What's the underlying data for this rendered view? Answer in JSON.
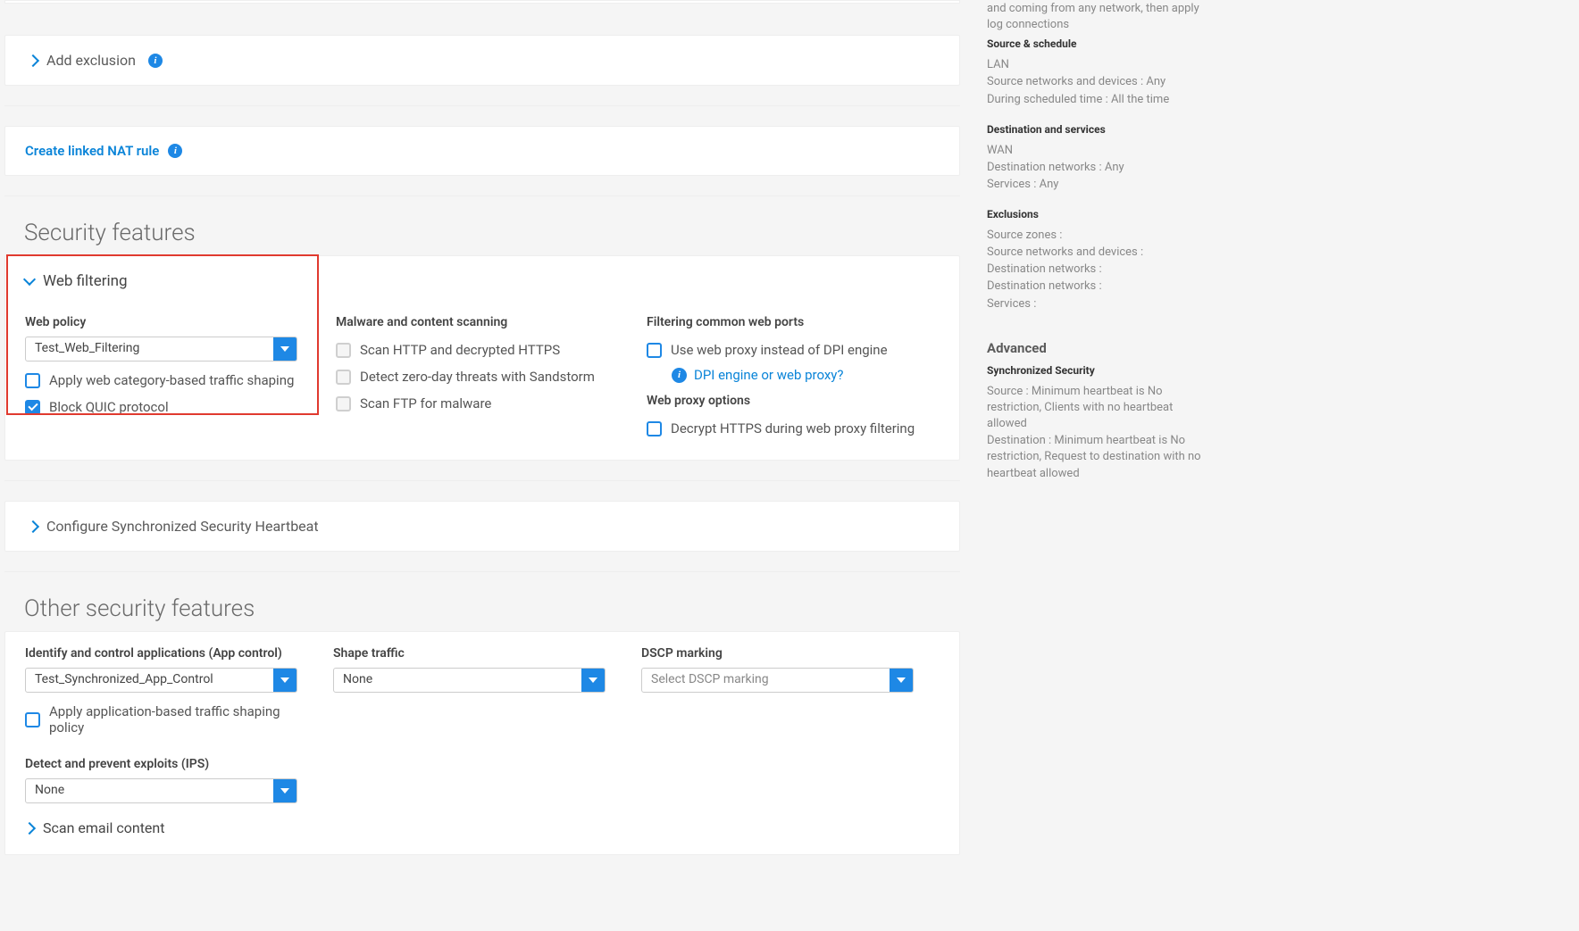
{
  "exclusion": {
    "label": "Add exclusion"
  },
  "nat": {
    "label": "Create linked NAT rule"
  },
  "security_features": {
    "title": "Security features",
    "web_filtering": {
      "header": "Web filtering",
      "web_policy_label": "Web policy",
      "web_policy_value": "Test_Web_Filtering",
      "apply_category": "Apply web category-based traffic shaping",
      "block_quic": "Block QUIC protocol",
      "malware_header": "Malware and content scanning",
      "scan_http": "Scan HTTP and decrypted HTTPS",
      "detect_zero": "Detect zero-day threats with Sandstorm",
      "scan_ftp": "Scan FTP for malware",
      "filtering_header": "Filtering common web ports",
      "use_proxy": "Use web proxy instead of DPI engine",
      "help_link": "DPI engine or web proxy?",
      "webproxy_header": "Web proxy options",
      "decrypt_https": "Decrypt HTTPS during web proxy filtering"
    },
    "sync_security": "Configure Synchronized Security Heartbeat"
  },
  "other": {
    "title": "Other security features",
    "app_control_label": "Identify and control applications (App control)",
    "app_control_value": "Test_Synchronized_App_Control",
    "apply_app_shaping": "Apply application-based traffic shaping policy",
    "shape_label": "Shape traffic",
    "shape_value": "None",
    "dscp_label": "DSCP marking",
    "dscp_placeholder": "Select DSCP marking",
    "ips_label": "Detect and prevent exploits (IPS)",
    "ips_value": "None",
    "scan_email": "Scan email content"
  },
  "sidebar": {
    "intro_tail": "and coming from any network, then apply log connections",
    "source_schedule": {
      "title": "Source & schedule",
      "lan": "LAN",
      "src_net": "Source networks and devices : Any",
      "during": "During scheduled time : All the time"
    },
    "dest_services": {
      "title": "Destination and services",
      "wan": "WAN",
      "dest_net": "Destination networks : Any",
      "services": "Services : Any"
    },
    "exclusions": {
      "title": "Exclusions",
      "src_zones": "Source zones :",
      "src_net": "Source networks and devices :",
      "dest_net1": "Destination networks :",
      "dest_net2": "Destination networks :",
      "services": "Services :"
    },
    "advanced": {
      "title": "Advanced",
      "sync_title": "Synchronized Security",
      "line1": "Source : Minimum heartbeat is No restriction, Clients with no heartbeat allowed",
      "line2": "Destination : Minimum heartbeat is No restriction, Request to destination with no heartbeat allowed"
    }
  }
}
